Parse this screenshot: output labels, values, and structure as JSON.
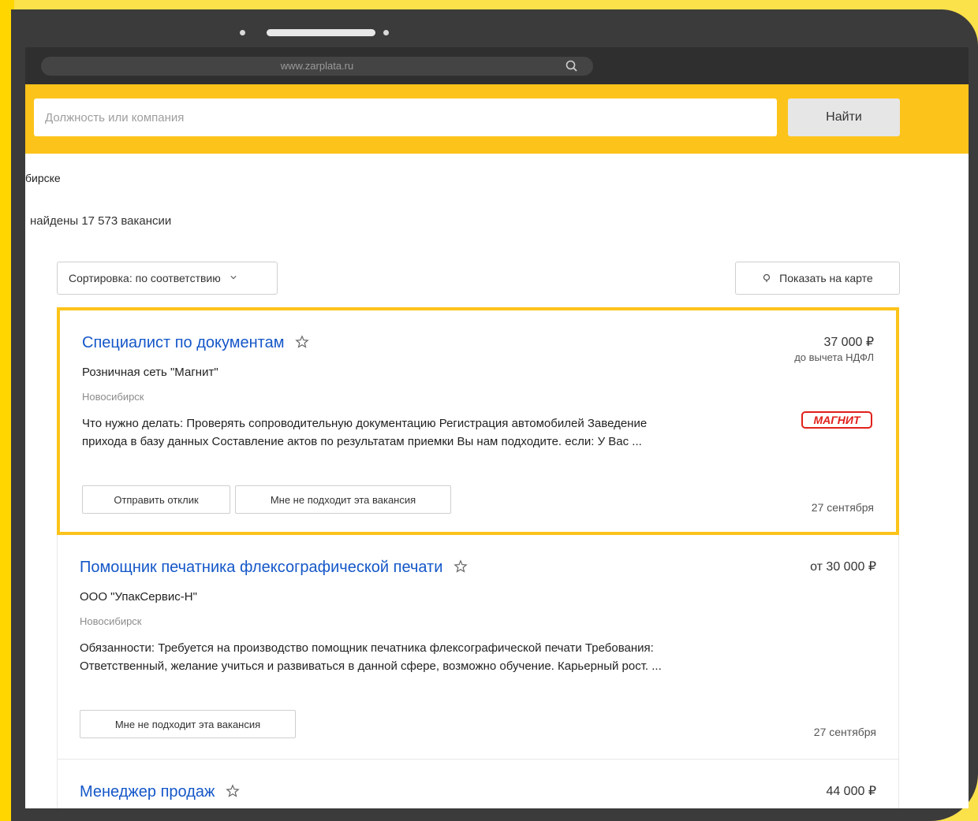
{
  "browser": {
    "url": "www.zarplata.ru"
  },
  "search": {
    "placeholder": "Должность или компания",
    "button_label": "Найти"
  },
  "location_text": "бирске",
  "results_text": "найдены 17 573 вакансии",
  "toolbar": {
    "sort_label": "Сортировка: по соответствию",
    "map_label": "Показать на карте"
  },
  "colors": {
    "accent": "#fcc31a",
    "link": "#1457c8",
    "brand_red": "#e1201a"
  },
  "jobs": [
    {
      "title": "Специалист по документам",
      "company": "Розничная сеть \"Магнит\"",
      "city": "Новосибирск",
      "description": "Что нужно делать: Проверять сопроводительную документацию Регистрация автомобилей Заведение прихода в базу данных Составление актов по результатам приемки Вы нам подходите. если: У Вас ...",
      "salary": "37 000 ₽",
      "salary_note": "до вычета НДФЛ",
      "logo_text": "МАГНИТ",
      "respond_label": "Отправить отклик",
      "reject_label": "Мне не подходит эта вакансия",
      "date": "27 сентября"
    },
    {
      "title": "Помощник печатника флексографической печати",
      "company": "ООО \"УпакСервис-Н\"",
      "city": "Новосибирск",
      "description": "Обязанности: Требуется на производство помощник печатника флексографической печати Требования: Ответственный, желание учиться и развиваться в данной сфере, возможно обучение. Карьерный рост. ...",
      "salary": "от 30 000 ₽",
      "reject_label": "Мне не подходит эта вакансия",
      "date": "27 сентября"
    },
    {
      "title": "Менеджер продаж",
      "salary": "44 000 ₽"
    }
  ]
}
